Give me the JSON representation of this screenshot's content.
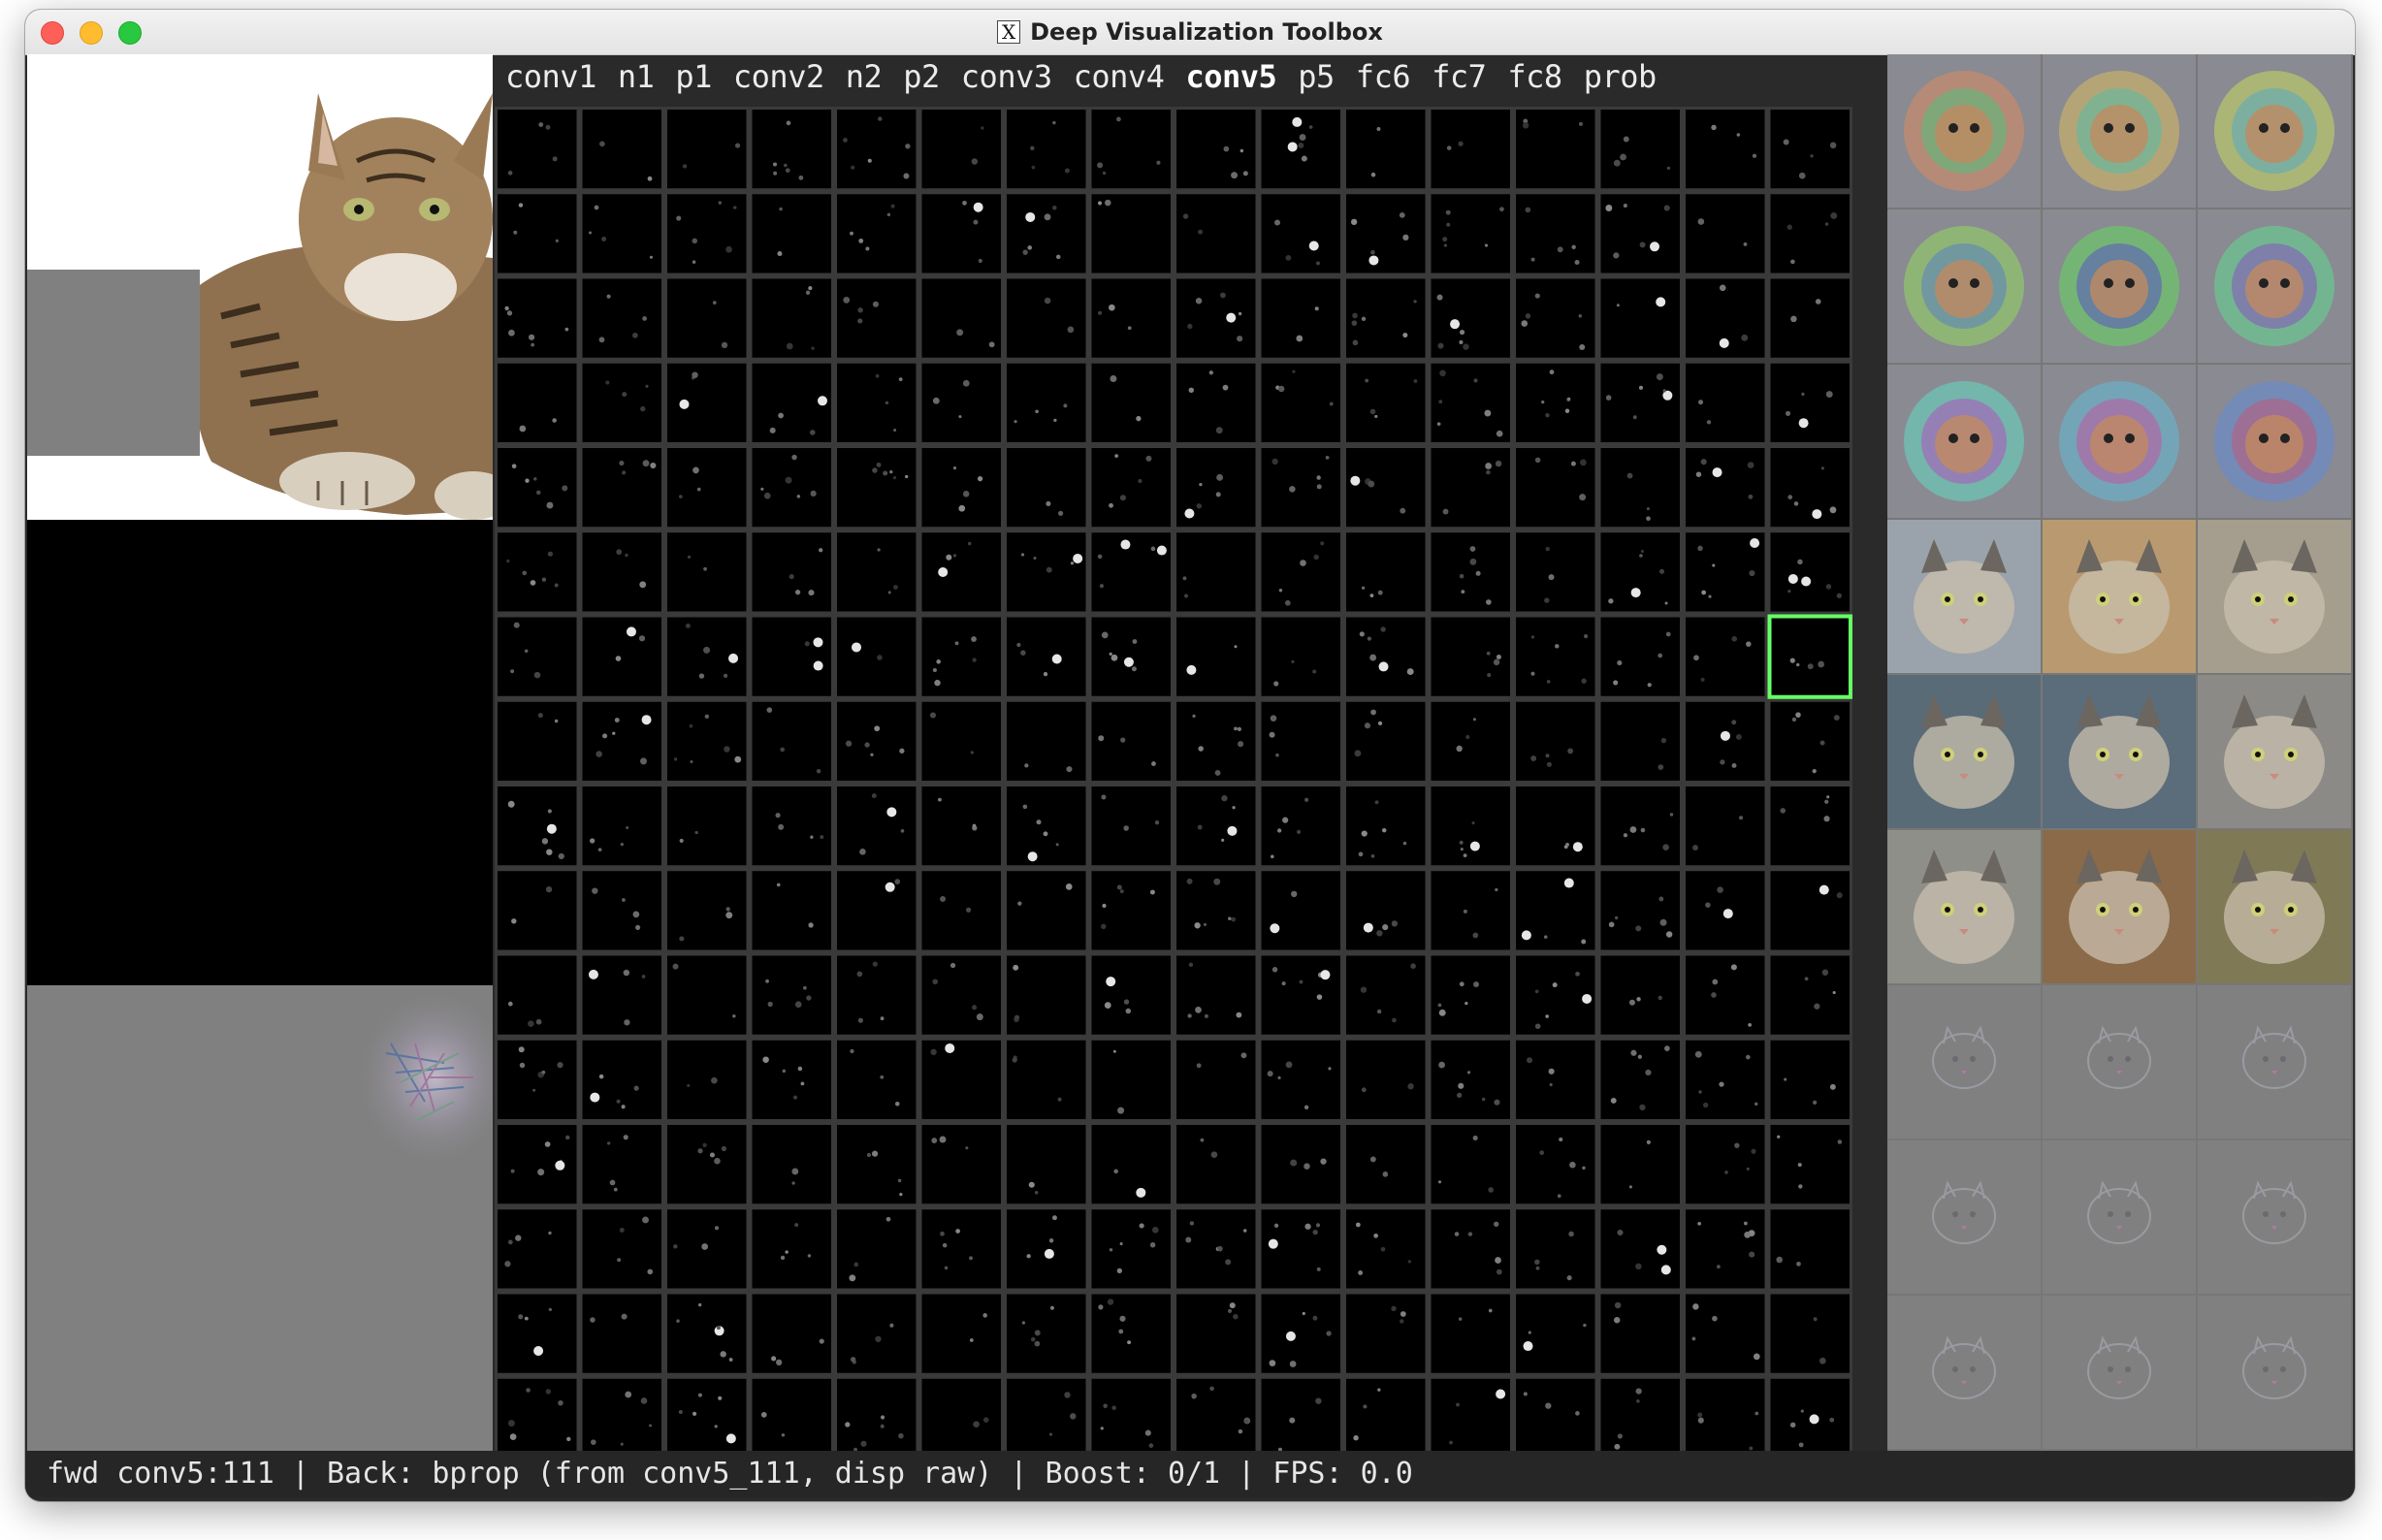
{
  "window": {
    "title": "Deep Visualization Toolbox",
    "title_icon": "x11-icon"
  },
  "layers": [
    {
      "label": "conv1",
      "active": false
    },
    {
      "label": "n1",
      "active": false
    },
    {
      "label": "p1",
      "active": false
    },
    {
      "label": "conv2",
      "active": false
    },
    {
      "label": "n2",
      "active": false
    },
    {
      "label": "p2",
      "active": false
    },
    {
      "label": "conv3",
      "active": false
    },
    {
      "label": "conv4",
      "active": false
    },
    {
      "label": "conv5",
      "active": true
    },
    {
      "label": "p5",
      "active": false
    },
    {
      "label": "fc6",
      "active": false
    },
    {
      "label": "fc7",
      "active": false
    },
    {
      "label": "fc8",
      "active": false
    },
    {
      "label": "prob",
      "active": false
    }
  ],
  "status": {
    "text": "fwd conv5:111 | Back: bprop (from conv5_111, disp raw) | Boost: 0/1 | FPS: 0.0"
  },
  "colors": {
    "selection": "#66ff66",
    "grid_line": "#3a3a3a",
    "window_bg": "#2a2a2a"
  },
  "grid": {
    "rows": 16,
    "cols": 16,
    "selected_unit": 111
  }
}
